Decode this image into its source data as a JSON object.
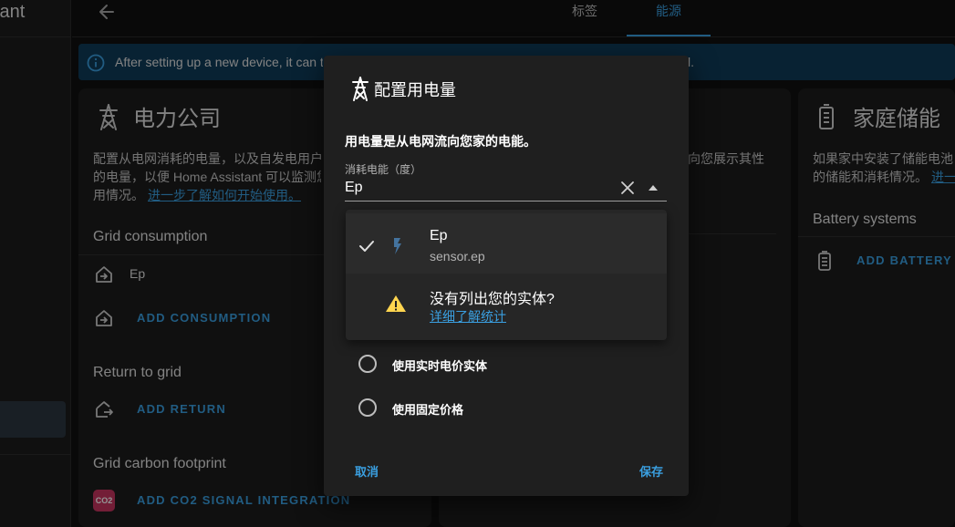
{
  "sidebar": {
    "title": "tant"
  },
  "header": {
    "tabs": [
      {
        "label": "标签",
        "active": false
      },
      {
        "label": "能源",
        "active": true
      }
    ]
  },
  "banner": {
    "text": "After setting up a new device, it can t",
    "tail": "l."
  },
  "grid_card": {
    "title": "电力公司",
    "desc_line1": "配置从电网消耗的电量，以及自发电用户",
    "desc_line2": "的电量，以便 Home Assistant 可以监测您",
    "desc_line3_prefix": "用情况。",
    "learn_link": "进一步了解如何开始使用。",
    "consumption_title": "Grid consumption",
    "consumption_item": "Ep",
    "add_consumption": "ADD CONSUMPTION",
    "return_title": "Return to grid",
    "add_return": "ADD RETURN",
    "carbon_title": "Grid carbon footprint",
    "add_co2": "ADD CO2 SIGNAL INTEGRATION",
    "co2_badge": "CO2"
  },
  "mid_card": {
    "desc_fragment": "向您展示其性"
  },
  "battery_card": {
    "title": "家庭储能",
    "desc_line1": "如果家中安装了储能电池",
    "desc_line2_prefix": "的储能和消耗情况。",
    "learn_link": "进一",
    "section_title": "Battery systems",
    "add_battery": "ADD BATTERY SY"
  },
  "dialog": {
    "title": "配置用电量",
    "description": "用电量是从电网流向您家的电能。",
    "field_label": "消耗电能（度）",
    "field_value": "Ep",
    "options": [
      {
        "name": "Ep",
        "entity_id": "sensor.ep",
        "selected": true
      }
    ],
    "missing_text": "没有列出您的实体?",
    "missing_link": "详细了解统计",
    "radio1": "使用实时电价实体",
    "radio2": "使用固定价格",
    "cancel": "取消",
    "save": "保存"
  },
  "colors": {
    "accent": "#3a9fe0",
    "background": "#111111",
    "card": "#1c1c1c",
    "dialog": "#1f1f1f",
    "warning": "#ffd54f"
  }
}
